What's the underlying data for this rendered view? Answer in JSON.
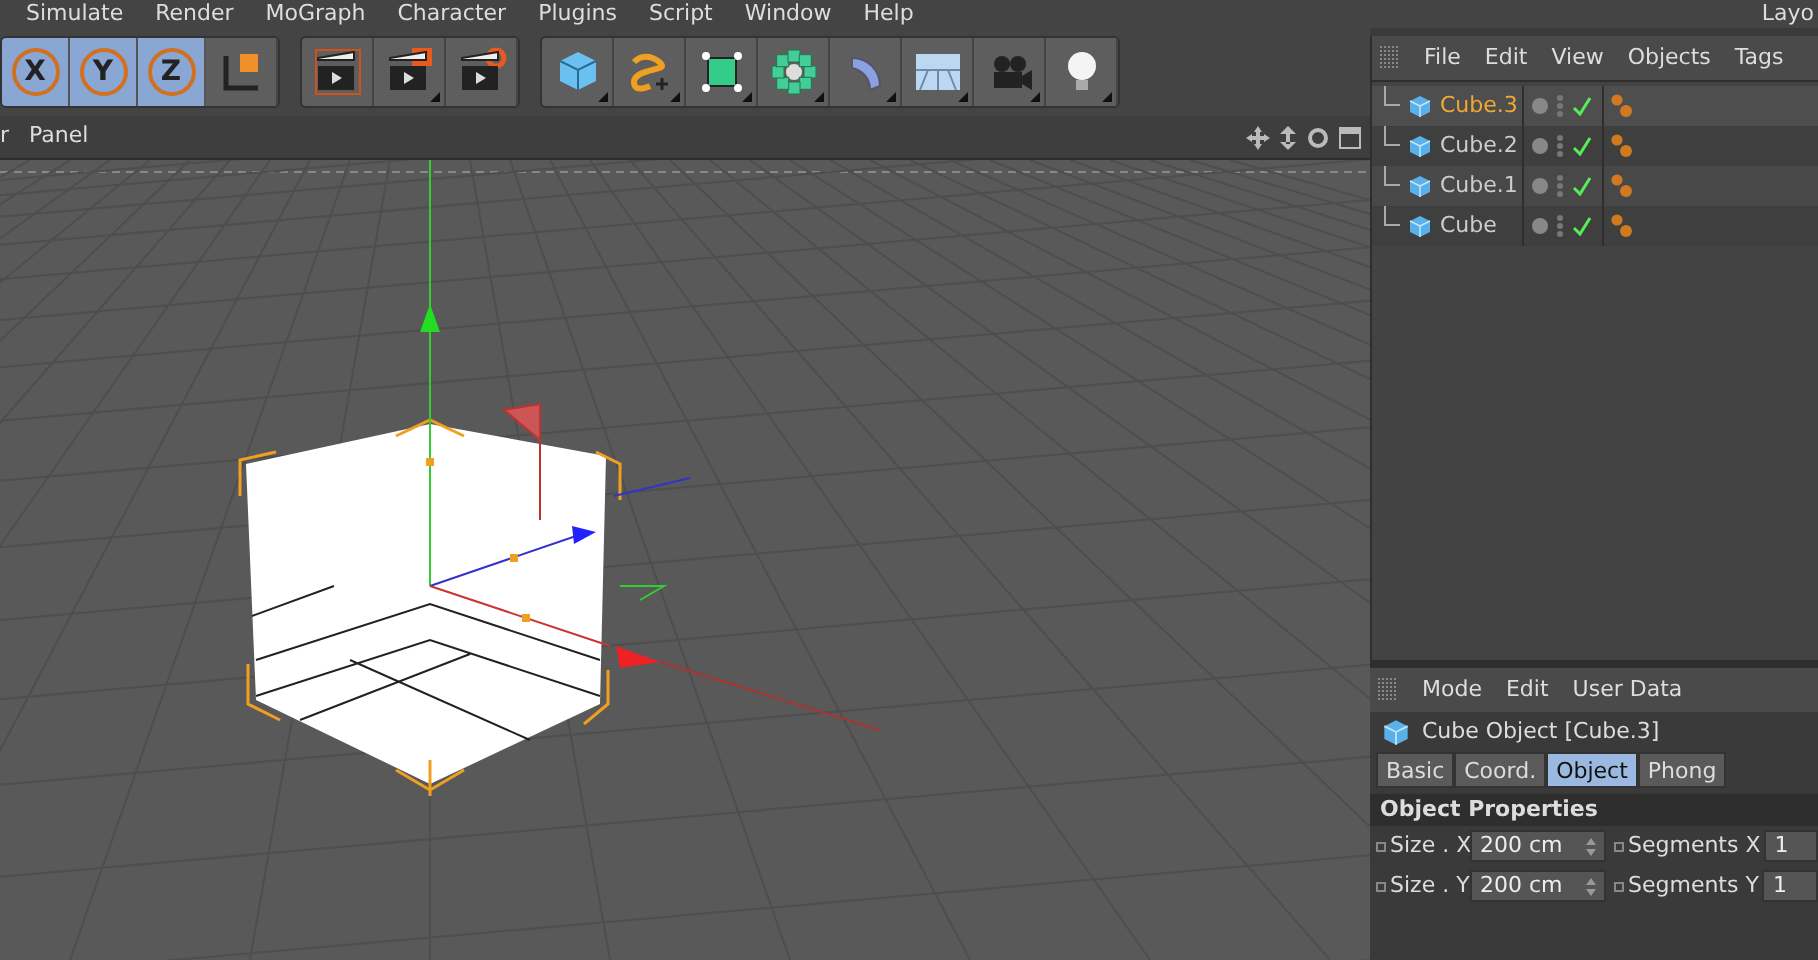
{
  "menu_bar": {
    "items": [
      "Simulate",
      "Render",
      "MoGraph",
      "Character",
      "Plugins",
      "Script",
      "Window",
      "Help"
    ],
    "layout_label": "Layo"
  },
  "toolbar": {
    "axis_buttons": [
      {
        "letter": "X",
        "selected": true
      },
      {
        "letter": "Y",
        "selected": true
      },
      {
        "letter": "Z",
        "selected": true
      }
    ]
  },
  "viewport": {
    "menu": [
      "r",
      "Panel"
    ]
  },
  "object_manager": {
    "menu": [
      "File",
      "Edit",
      "View",
      "Objects",
      "Tags"
    ],
    "objects": [
      {
        "name": "Cube.3",
        "selected": true
      },
      {
        "name": "Cube.2",
        "selected": false
      },
      {
        "name": "Cube.1",
        "selected": false
      },
      {
        "name": "Cube",
        "selected": false
      }
    ]
  },
  "attribute_manager": {
    "menu": [
      "Mode",
      "Edit",
      "User Data"
    ],
    "title": "Cube Object [Cube.3]",
    "tabs": [
      {
        "label": "Basic",
        "selected": false
      },
      {
        "label": "Coord.",
        "selected": false
      },
      {
        "label": "Object",
        "selected": true
      },
      {
        "label": "Phong",
        "selected": false
      }
    ],
    "section": "Object Properties",
    "fields": [
      {
        "label": "Size . X",
        "value": "200 cm",
        "label_2": "Segments X",
        "value_2": "1"
      },
      {
        "label": "Size . Y",
        "value": "200 cm",
        "label_2": "Segments Y",
        "value_2": "1"
      }
    ]
  }
}
